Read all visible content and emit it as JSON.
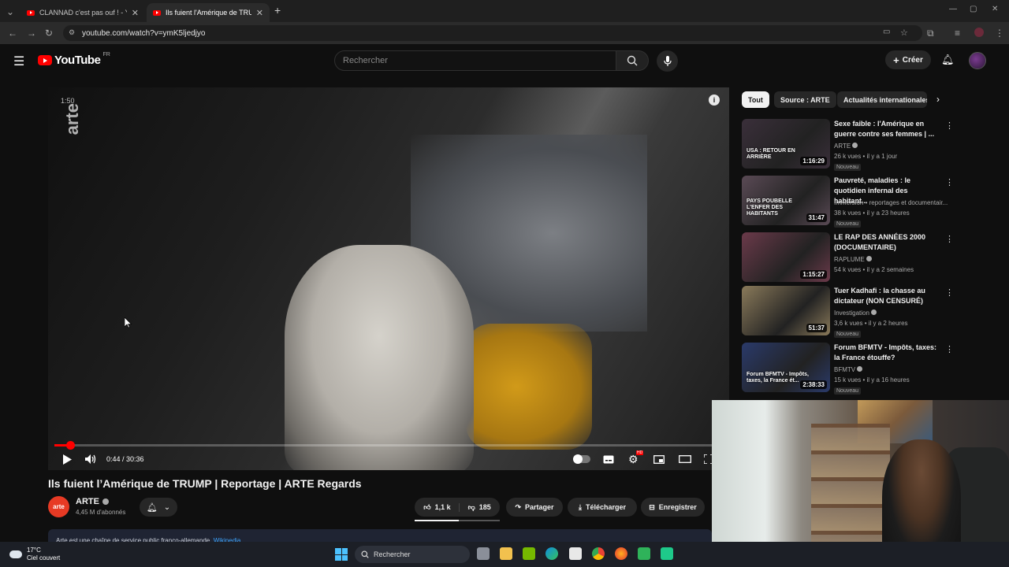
{
  "browser": {
    "tabs": [
      {
        "title": "CLANNAD c'est pas ouf ! - YouTube",
        "active": false
      },
      {
        "title": "Ils fuient l'Amérique de TRUMP",
        "active": true
      }
    ],
    "new_tab": "+",
    "url": "youtube.com/watch?v=ymK5ljedjyo"
  },
  "header": {
    "logo_text": "YouTube",
    "country_code": "FR",
    "search_placeholder": "Rechercher",
    "create_label": "Créer"
  },
  "player": {
    "watermark": "arte",
    "top_timestamp": "1:50",
    "current_time": "0:44",
    "duration": "30:36",
    "time_display": "0:44 / 30:36",
    "progress": 0.024,
    "hd_badge": "HD"
  },
  "video": {
    "title": "Ils fuient l’Amérique de TRUMP | Reportage | ARTE Regards",
    "channel_name": "ARTE",
    "channel_avatar_text": "arte",
    "subscribers": "4,45 M d'abonnés",
    "likes": "1,1 k",
    "dislikes": "185",
    "share_label": "Partager",
    "download_label": "Télécharger",
    "save_label": "Enregistrer",
    "description_preview": "Arte est une chaîne de service public franco-allemande.",
    "description_link": "Wikipedia"
  },
  "sidebar": {
    "chips": [
      {
        "label": "Tout",
        "active": true
      },
      {
        "label": "Source : ARTE",
        "active": false
      },
      {
        "label": "Actualités internationales",
        "active": false
      }
    ],
    "recommendations": [
      {
        "title": "Sexe faible : l'Amérique en guerre contre ses femmes | ...",
        "channel": "ARTE",
        "verified": true,
        "views": "26 k vues",
        "age": "il y a 1 jour",
        "duration": "1:16:29",
        "badge": "Nouveau",
        "thumb_caption": "USA : RETOUR EN ARRIÈRE",
        "thumb_color": "#3a2f3a"
      },
      {
        "title": "Pauvreté, maladies : le quotidien infernal des habitant...",
        "channel": "Immersion",
        "channel_extra": "reportages et documentair...",
        "verified": false,
        "views": "38 k vues",
        "age": "il y a 23 heures",
        "duration": "31:47",
        "badge": "Nouveau",
        "thumb_caption": "PAYS POUBELLE L'ENFER DES HABITANTS",
        "thumb_color": "#5a4a55"
      },
      {
        "title": "LE RAP DES ANNÉES 2000 (DOCUMENTAIRE)",
        "channel": "RAPLUME",
        "verified": true,
        "views": "54 k vues",
        "age": "il y a 2 semaines",
        "duration": "1:15:27",
        "badge": "",
        "thumb_caption": "",
        "thumb_color": "#6b3a4a"
      },
      {
        "title": "Tuer Kadhafi : la chasse au dictateur (NON CENSURÉ)",
        "channel": "Investigation",
        "verified": true,
        "views": "3,6 k vues",
        "age": "il y a 2 heures",
        "duration": "51:37",
        "badge": "Nouveau",
        "thumb_caption": "",
        "thumb_color": "#8a7a5a"
      },
      {
        "title": "Forum BFMTV - Impôts, taxes: la France étouffe?",
        "channel": "BFMTV",
        "verified": true,
        "views": "15 k vues",
        "age": "il y a 16 heures",
        "duration": "2:38:33",
        "badge": "Nouveau",
        "thumb_caption": "Forum BFMTV - Impôts, taxes, la France ét...",
        "thumb_color": "#2a3a6a"
      }
    ]
  },
  "taskbar": {
    "temperature": "17°C",
    "weather_desc": "Ciel couvert",
    "search_label": "Rechercher"
  },
  "colors": {
    "accent_red": "#ff0000",
    "background": "#0f0f0f",
    "pill_bg": "#272727",
    "taskbar": "#1c1f26"
  }
}
